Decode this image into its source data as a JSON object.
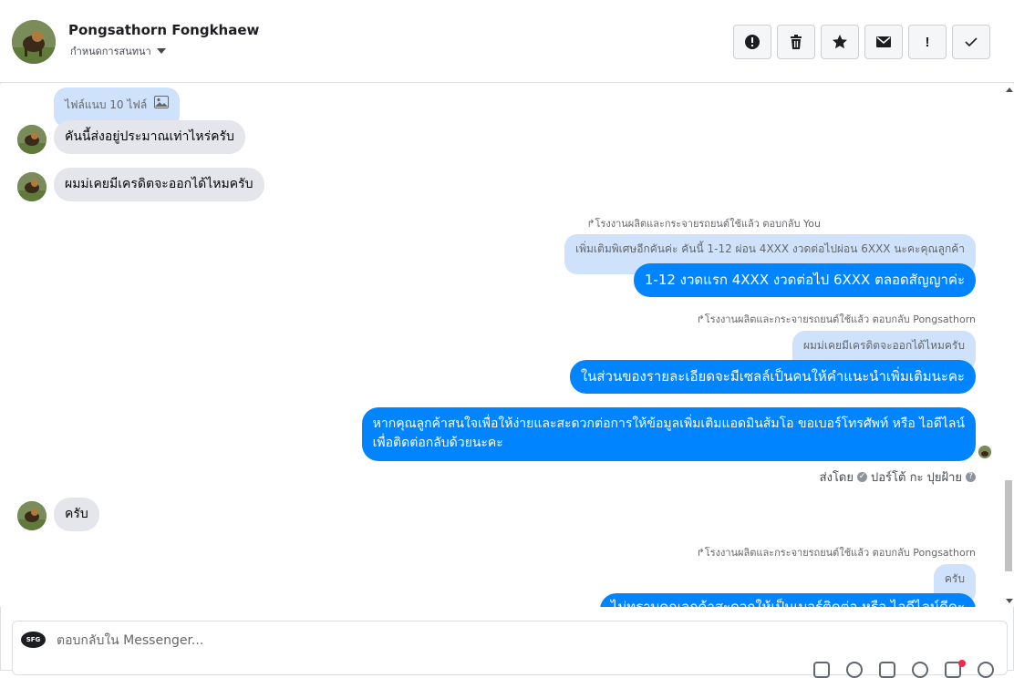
{
  "header": {
    "name": "Pongsathorn Fongkhaew",
    "subtitle": "กำหนดการสนทนา",
    "actions": [
      {
        "name": "report-icon",
        "label": ""
      },
      {
        "name": "trash-icon",
        "label": ""
      },
      {
        "name": "star-icon",
        "label": ""
      },
      {
        "name": "envelope-icon",
        "label": ""
      },
      {
        "name": "exclamation-icon",
        "label": "!"
      },
      {
        "name": "checkmark-icon",
        "label": "✓"
      }
    ]
  },
  "thread": {
    "attachment_label": "ไฟล์แนบ 10 ไฟล์",
    "msg_in_1": "คันนี้ส่งอยู่ประมาณเท่าไหร่ครับ",
    "msg_in_2": "ผมม่เคยมีเครดิตจะออกได้ไหมครับ",
    "reply_label_1": "โรงงานผลิตและกระจายรถยนต์ใช้แล้ว ตอบกลับ You",
    "quote_1": "เพิ่มเติมพิเศษอีกคันค่ะ คันนี้ 1-12 ผ่อน 4XXX งวดต่อไปผ่อน 6XXX นะคะคุณลูกค้า",
    "msg_out_1": "1-12 งวดแรก 4XXX งวดต่อไป 6XXX ตลอดสัญญาค่ะ",
    "reply_label_2": "โรงงานผลิตและกระจายรถยนต์ใช้แล้ว ตอบกลับ Pongsathorn",
    "quote_2": "ผมม่เคยมีเครดิตจะออกได้ไหมครับ",
    "msg_out_2": "ในส่วนของรายละเอียดจะมีเซลล์เป็นคนให้คำแนะนำเพิ่มเติมนะคะ",
    "msg_out_3_line1": "หากคุณลูกค้าสนใจเพื่อให้ง่ายและสะดวกต่อการให้ข้อมูลเพิ่มเติมแอดมินส้มโอ ขอเบอร์โทรศัพท์ หรือ ไอดีไลน์",
    "msg_out_3_line2": "เพื่อติดต่อกลับด้วยนะคะ",
    "sent_by_prefix": "ส่งโดย",
    "sent_by_name": "ปอร์โต้ กะ ปุยฝ้าย",
    "msg_in_3": "ครับ",
    "reply_label_3": "โรงงานผลิตและกระจายรถยนต์ใช้แล้ว ตอบกลับ Pongsathorn",
    "quote_3": "ครับ",
    "msg_out_4_partial": "ไม่ทราบคุณลูกค้าสะดวกให้เป็นเบอร์ติดต่อ หรือ ไอดีไลน์ดีคะ"
  },
  "composer": {
    "placeholder": "ตอบกลับใน Messenger...",
    "avatar_text": "SFG"
  }
}
